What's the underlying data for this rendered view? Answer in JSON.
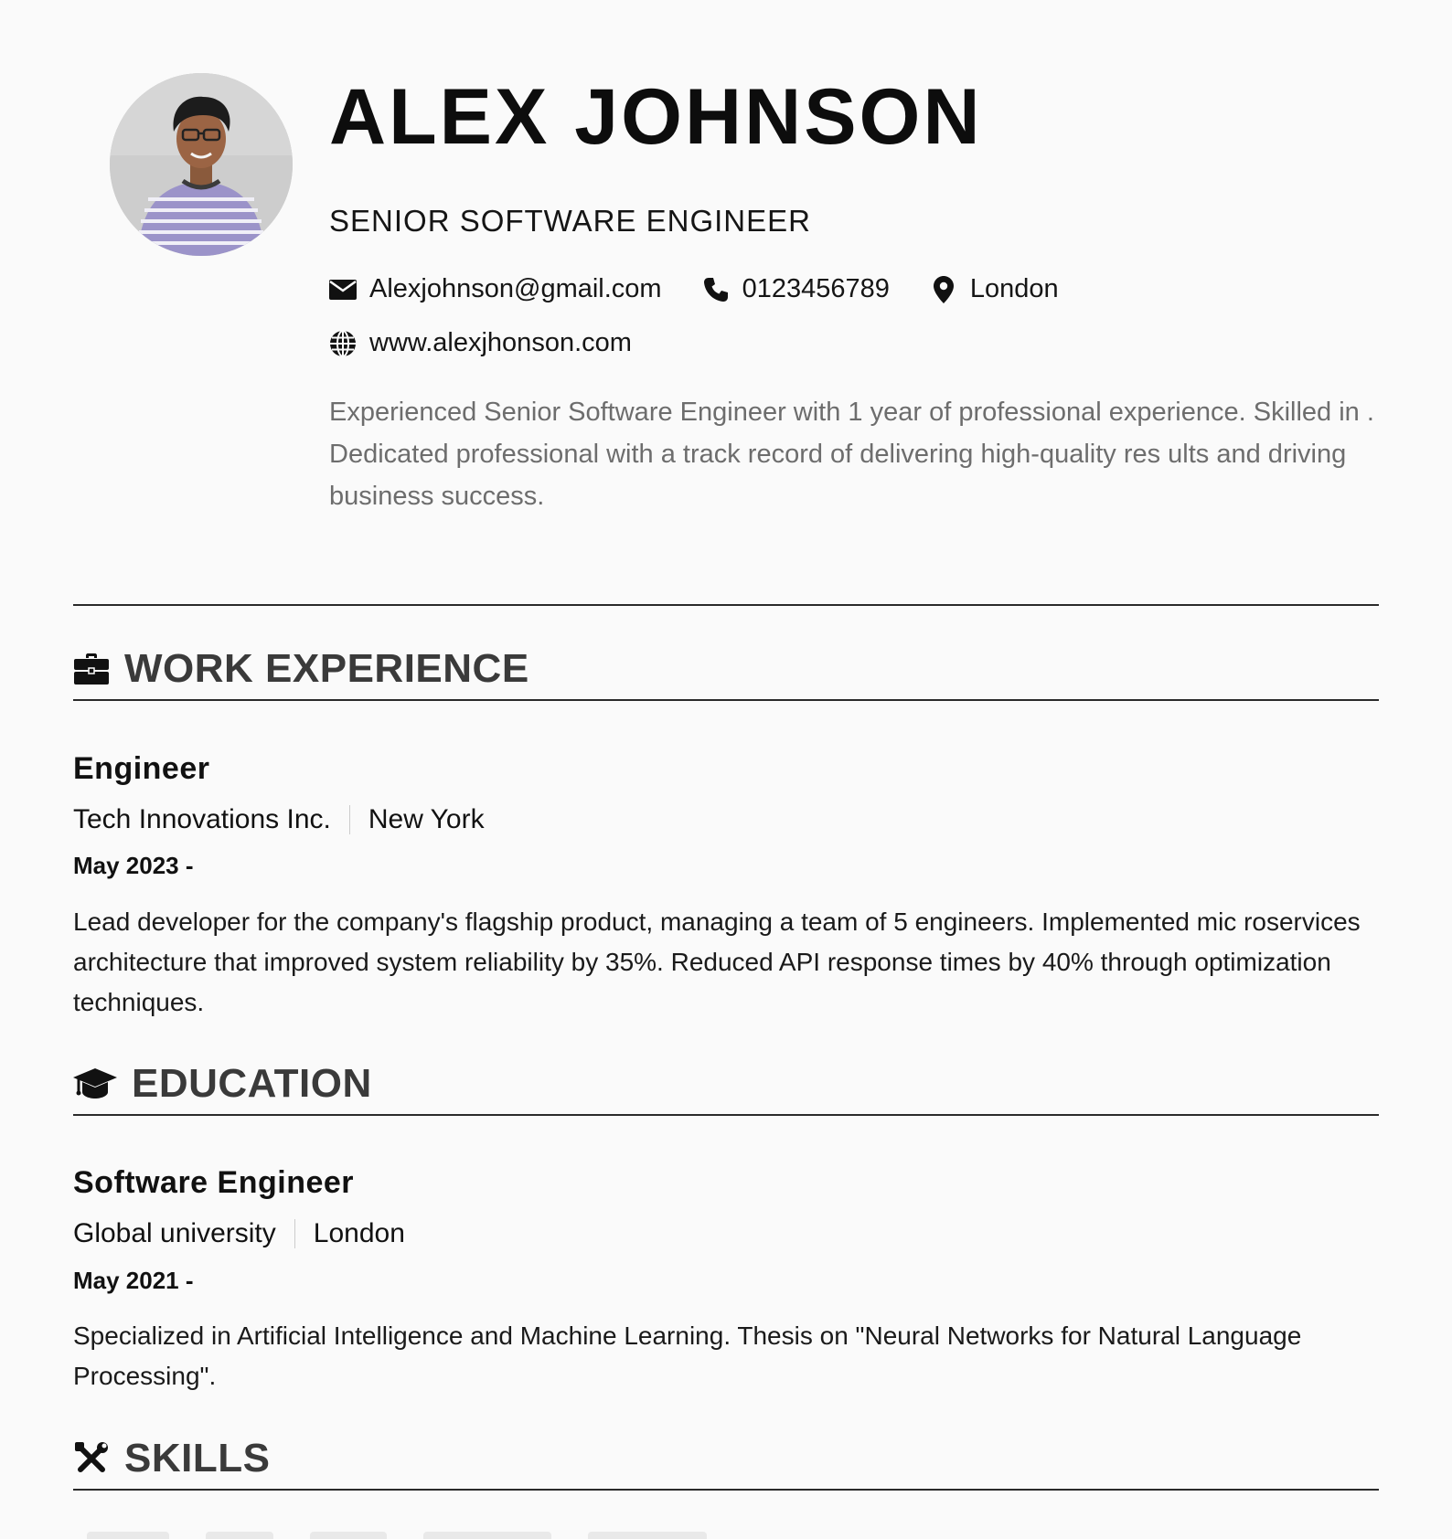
{
  "header": {
    "name": "ALEX JOHNSON",
    "title": "SENIOR SOFTWARE ENGINEER",
    "contacts": {
      "email": "Alexjohnson@gmail.com",
      "phone": "0123456789",
      "location": "London",
      "website": "www.alexjhonson.com"
    },
    "summary": "Experienced Senior Software Engineer with 1 year of professional experience. Skilled in . Dedicated professional with a track record of delivering high-quality res ults and driving business success."
  },
  "sections": {
    "work": {
      "heading": "WORK EXPERIENCE",
      "icon": "briefcase-icon",
      "entries": [
        {
          "title": "Engineer",
          "company": "Tech Innovations Inc.",
          "location": "New York",
          "date": "May 2023 -",
          "description": "Lead developer for the company's flagship product, managing a team of 5 engineers. Implemented mic roservices architecture that improved system reliability by 35%. Reduced API response times by 40% through optimization techniques."
        }
      ]
    },
    "education": {
      "heading": "EDUCATION",
      "icon": "graduation-cap-icon",
      "entries": [
        {
          "title": "Software Engineer",
          "institution": "Global university",
          "location": "London",
          "date": "May 2021 -",
          "description": "Specialized in Artificial Intelligence and Machine Learning. Thesis on \"Neural Networks for Natural Language Processing\"."
        }
      ]
    },
    "skills": {
      "heading": "SKILLS",
      "icon": "tools-icon"
    }
  },
  "colors": {
    "background": "#fafafa",
    "text": "#111111",
    "heading": "#3a3a3a",
    "muted": "#6d6d6d",
    "rule": "#2a2a2a"
  }
}
